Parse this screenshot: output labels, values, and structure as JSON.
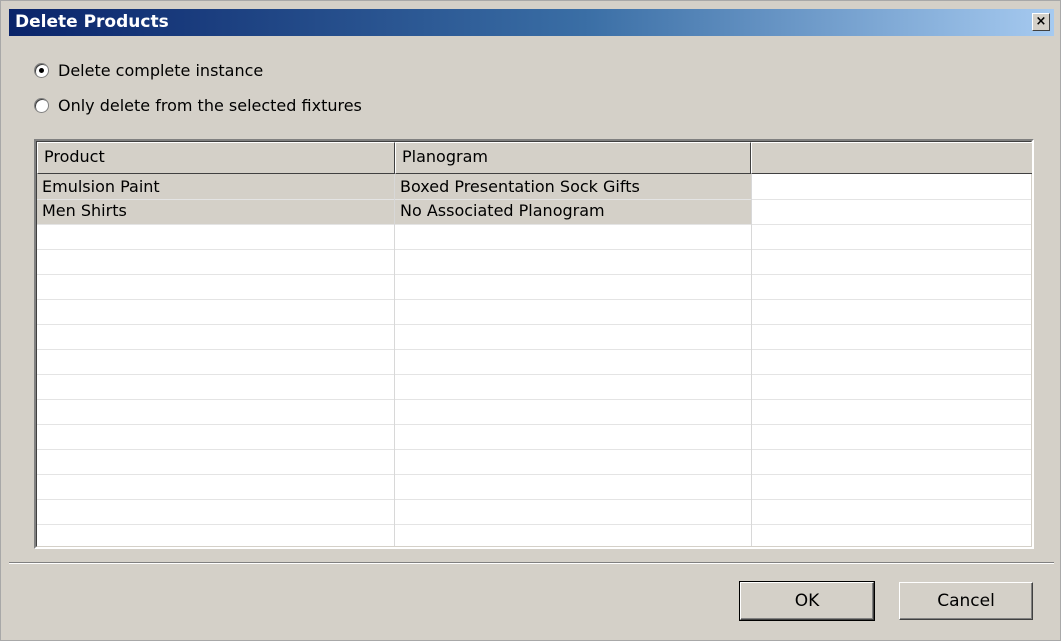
{
  "dialog": {
    "title": "Delete Products",
    "close_label": "×"
  },
  "options": [
    {
      "label": "Delete complete instance",
      "selected": true
    },
    {
      "label": "Only delete from the selected fixtures",
      "selected": false
    }
  ],
  "table": {
    "columns": [
      "Product",
      "Planogram",
      ""
    ],
    "rows": [
      {
        "product": "Emulsion Paint",
        "planogram": "Boxed Presentation Sock Gifts"
      },
      {
        "product": "Men Shirts",
        "planogram": "No Associated Planogram"
      }
    ]
  },
  "buttons": {
    "ok_label": "OK",
    "cancel_label": "Cancel"
  }
}
